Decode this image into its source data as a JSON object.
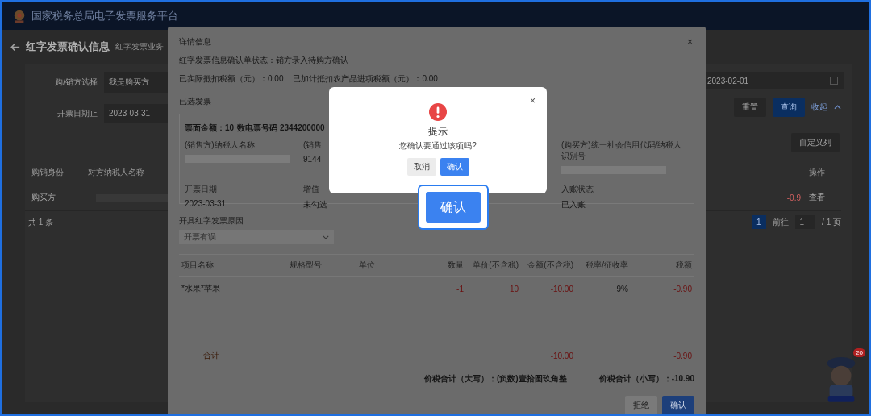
{
  "header": {
    "title": "国家税务总局电子发票服务平台"
  },
  "page": {
    "title": "红字发票确认信息",
    "breadcrumb": "红字发票业务"
  },
  "filters": [
    {
      "label": "购/销方选择",
      "value": "我是购买方"
    },
    {
      "label": "开票日期止",
      "value": "2023-03-31"
    }
  ],
  "date_field": {
    "value": "2023-02-01"
  },
  "filter_buttons": {
    "reset": "重置",
    "search": "查询",
    "collapse": "收起"
  },
  "custom_columns": "自定义列",
  "table": {
    "columns": [
      "购销身份",
      "对方纳税人名称",
      "操作"
    ],
    "rows": [
      {
        "identity": "购买方",
        "amount": "-0.9",
        "action": "查看"
      }
    ]
  },
  "pagination": {
    "total": "共 1 条",
    "page": "1",
    "goto": "前往",
    "goto_value": "1",
    "pages": "/ 1 页"
  },
  "detail": {
    "title": "详情信息",
    "close": "×",
    "status": "红字发票信息确认单状态：销方录入待购方确认",
    "deductions": [
      "已实际抵扣税额（元）：0.00",
      "已加计抵扣农产品进项税额（元）：0.00"
    ],
    "section": "已选发票",
    "card": {
      "amount": "票面金额：10",
      "number": "数电票号码 2344200000",
      "fields": [
        {
          "label": "(销售方)纳税人名称",
          "redacted": true
        },
        {
          "label": "(销售",
          "value": "9144",
          "redacted": false
        },
        {
          "label": "(购买方)统一社会信用代码/纳税人识别号",
          "redacted": true
        },
        {
          "label": "开票日期",
          "value": "2023-03-31",
          "redacted": false
        },
        {
          "label": "增值",
          "value": "未勾选",
          "redacted": false
        },
        {
          "label": "入账状态",
          "value": "已入账",
          "redacted": false
        }
      ]
    },
    "reason": {
      "label": "开具红字发票原因",
      "value": "开票有误"
    },
    "items": {
      "columns": [
        "项目名称",
        "规格型号",
        "单位",
        "数量",
        "单价(不含税)",
        "金额(不含税)",
        "税率/征收率",
        "税额"
      ],
      "rows": [
        {
          "name": "*水果*苹果",
          "quantity": "-1",
          "unit_price": "10",
          "amount": "-10.00",
          "tax_rate": "9%",
          "tax": "-0.90",
          "negative": true
        }
      ],
      "total": {
        "label": "合计",
        "amount": "-10.00",
        "tax": "-0.90",
        "negative": true
      }
    },
    "summary": [
      "价税合计（大写）：(负数)壹拾圆玖角整",
      "价税合计（小写）：-10.90"
    ],
    "buttons": {
      "reject": "拒绝",
      "confirm": "确认"
    }
  },
  "dialog": {
    "close": "×",
    "title": "提示",
    "message": "您确认要通过该项吗?",
    "cancel": "取消",
    "ok": "确认"
  },
  "callout": {
    "label": "确认"
  },
  "assistant": {
    "badge": "20"
  }
}
